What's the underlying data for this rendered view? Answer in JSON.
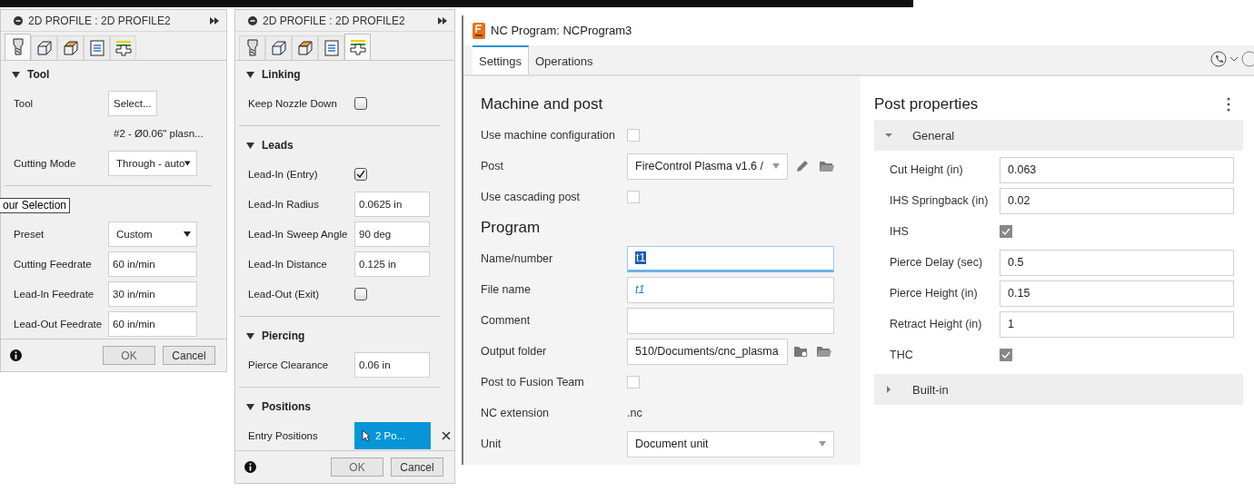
{
  "profile_panels": [
    {
      "title": "2D PROFILE : 2D PROFILE2",
      "tabs": [
        {
          "kind": "tool",
          "selected": true
        },
        {
          "kind": "geometry",
          "selected": false
        },
        {
          "kind": "heights",
          "selected": false
        },
        {
          "kind": "passes",
          "selected": false
        },
        {
          "kind": "linking",
          "selected": false
        }
      ],
      "sections": [
        {
          "title": "Tool",
          "expanded": true,
          "rows": [
            {
              "kind": "button",
              "label": "Tool",
              "value": "Select..."
            },
            {
              "kind": "note",
              "value": "#2 - Ø0.06\" plasn..."
            },
            {
              "kind": "select",
              "label": "Cutting Mode",
              "value": "Through - auto"
            }
          ]
        },
        {
          "rows": [
            {
              "kind": "link",
              "value": "our Selection"
            },
            {
              "kind": "select",
              "label": "Preset",
              "value": "Custom"
            },
            {
              "kind": "input",
              "label": "Cutting Feedrate",
              "value": "60 in/min"
            },
            {
              "kind": "input",
              "label": "Lead-In Feedrate",
              "value": "30 in/min"
            },
            {
              "kind": "input",
              "label": "Lead-Out Feedrate",
              "value": "60 in/min"
            }
          ]
        }
      ],
      "buttons": [
        "OK",
        "Cancel"
      ]
    },
    {
      "title": "2D PROFILE : 2D PROFILE2",
      "tabs": [
        {
          "kind": "tool",
          "selected": false
        },
        {
          "kind": "geometry",
          "selected": false
        },
        {
          "kind": "heights",
          "selected": false
        },
        {
          "kind": "passes",
          "selected": false
        },
        {
          "kind": "linking",
          "selected": true
        }
      ],
      "sections": [
        {
          "title": "Linking",
          "expanded": true,
          "rows": [
            {
              "kind": "checkbox",
              "label": "Keep Nozzle Down",
              "checked": false
            }
          ]
        },
        {
          "title": "Leads",
          "expanded": true,
          "rows": [
            {
              "kind": "checkbox",
              "label": "Lead-In (Entry)",
              "checked": true
            },
            {
              "kind": "input",
              "label": "Lead-In Radius",
              "value": "0.0625 in"
            },
            {
              "kind": "input",
              "label": "Lead-In Sweep Angle",
              "value": "90 deg"
            },
            {
              "kind": "input",
              "label": "Lead-In Distance",
              "value": "0.125 in"
            },
            {
              "kind": "checkbox",
              "label": "Lead-Out (Exit)",
              "checked": false
            }
          ]
        },
        {
          "title": "Piercing",
          "expanded": true,
          "rows": [
            {
              "kind": "input",
              "label": "Pierce Clearance",
              "value": "0.06 in"
            }
          ]
        },
        {
          "title": "Positions",
          "expanded": true,
          "rows": [
            {
              "kind": "chip",
              "label": "Entry Positions",
              "value": "2 Po..."
            }
          ]
        }
      ],
      "buttons": [
        "OK",
        "Cancel"
      ]
    }
  ],
  "nc_window": {
    "title": "NC Program: NCProgram3",
    "tabs": [
      {
        "label": "Settings",
        "selected": true
      },
      {
        "label": "Operations",
        "selected": false
      }
    ],
    "settings": [
      {
        "heading": "Machine and post",
        "rows": [
          {
            "kind": "checkbox",
            "label": "Use machine configuration",
            "checked": false
          },
          {
            "kind": "post",
            "label": "Post",
            "value": "FireControl Plasma v1.6 /"
          },
          {
            "kind": "checkbox",
            "label": "Use cascading post",
            "checked": false
          }
        ]
      },
      {
        "heading": "Program",
        "rows": [
          {
            "kind": "focused",
            "label": "Name/number",
            "value": "t1"
          },
          {
            "kind": "input",
            "label": "File name",
            "placeholder": "t1"
          },
          {
            "kind": "input",
            "label": "Comment"
          },
          {
            "kind": "folder",
            "label": "Output folder",
            "value": "510/Documents/cnc_plasma"
          },
          {
            "kind": "checkbox",
            "label": "Post to Fusion Team",
            "checked": false
          },
          {
            "kind": "text",
            "label": "NC extension",
            "value": ".nc"
          },
          {
            "kind": "select",
            "label": "Unit",
            "value": "Document unit"
          }
        ]
      }
    ],
    "post_properties": {
      "title": "Post properties",
      "groups": [
        {
          "label": "General",
          "expanded": true,
          "rows": [
            {
              "kind": "input",
              "label": "Cut Height (in)",
              "value": "0.063"
            },
            {
              "kind": "input",
              "label": "IHS Springback (in)",
              "value": "0.02"
            },
            {
              "kind": "checkbox",
              "label": "IHS",
              "checked": true
            },
            {
              "kind": "input",
              "label": "Pierce Delay (sec)",
              "value": "0.5"
            },
            {
              "kind": "input",
              "label": "Pierce Height (in)",
              "value": "0.15"
            },
            {
              "kind": "input",
              "label": "Retract Height (in)",
              "value": "1"
            },
            {
              "kind": "checkbox",
              "label": "THC",
              "checked": true
            }
          ]
        },
        {
          "label": "Built-in",
          "expanded": false
        }
      ]
    }
  }
}
